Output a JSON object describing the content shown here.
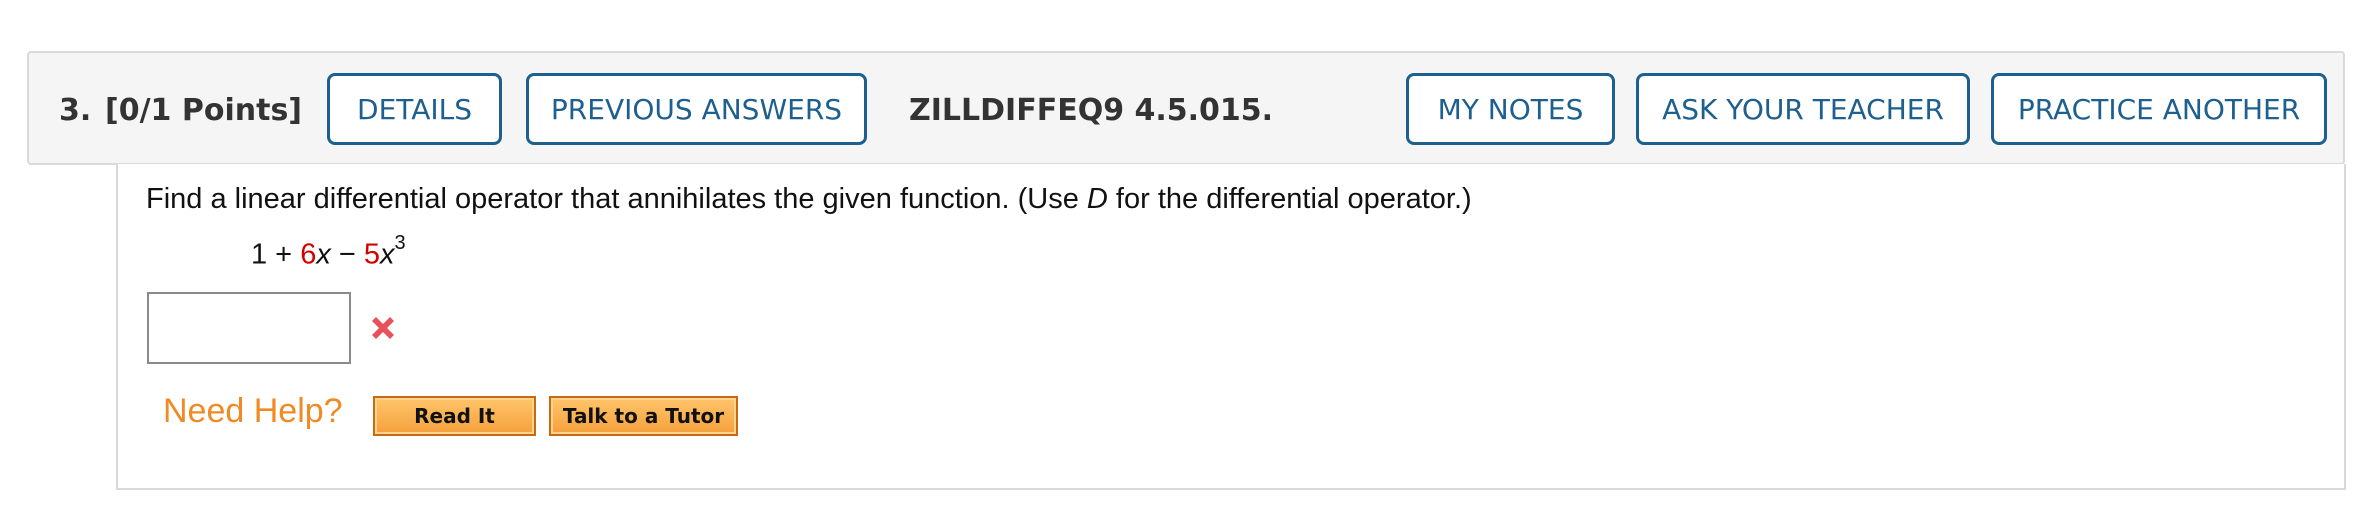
{
  "question": {
    "number": "3.",
    "points": "[0/1 Points]",
    "code": "ZILLDIFFEQ9 4.5.015."
  },
  "header_buttons": {
    "details": "DETAILS",
    "previous_answers": "PREVIOUS ANSWERS",
    "my_notes": "MY NOTES",
    "ask_teacher": "ASK YOUR TEACHER",
    "practice_another": "PRACTICE ANOTHER"
  },
  "prompt": {
    "before_var": "Find a linear differential operator that annihilates the given function. (Use ",
    "var": "D",
    "after_var": " for the differential operator.)"
  },
  "expression": {
    "const_term": "1 + ",
    "coef1": "6",
    "var1": "x",
    "minus": " − ",
    "coef2": "5",
    "var2": "x",
    "exp2": "3"
  },
  "answer": {
    "value": "",
    "status": "incorrect",
    "status_icon": "x-mark-icon"
  },
  "help": {
    "label": "Need Help?",
    "read_it": "Read It",
    "talk_to_tutor": "Talk to a Tutor"
  },
  "colors": {
    "button_border": "#1d5f8f",
    "highlight_red": "#d40000",
    "help_orange": "#f08a24",
    "wrong_mark": "#e8505b"
  }
}
